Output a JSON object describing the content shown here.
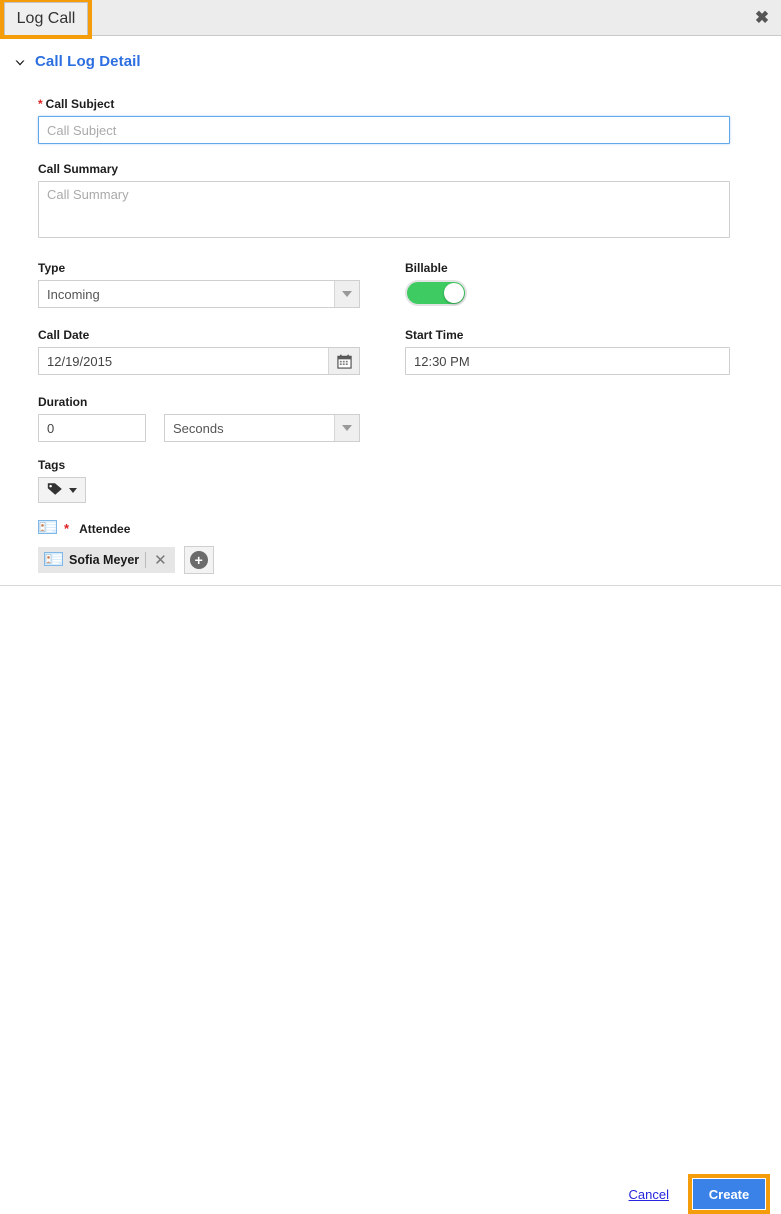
{
  "window": {
    "tab_label": "Log Call",
    "close_icon": "close-icon"
  },
  "section": {
    "title": "Call Log Detail",
    "chevron_icon": "chevron-down-icon",
    "expanded": true
  },
  "fields": {
    "call_subject": {
      "label": "Call Subject",
      "required_marker": "*",
      "value": "",
      "placeholder": "Call Subject",
      "focused": true
    },
    "call_summary": {
      "label": "Call Summary",
      "value": "",
      "placeholder": "Call Summary"
    },
    "type": {
      "label": "Type",
      "value": "Incoming",
      "options": [
        "Incoming"
      ],
      "arrow_icon": "chevron-down-icon"
    },
    "billable": {
      "label": "Billable",
      "state": "on",
      "on_color": "#3ecb62"
    },
    "call_date": {
      "label": "Call Date",
      "value": "12/19/2015",
      "calendar_icon": "calendar-icon"
    },
    "start_time": {
      "label": "Start Time",
      "value": "12:30 PM"
    },
    "duration": {
      "label": "Duration",
      "amount": "0",
      "unit": "Seconds",
      "unit_options": [
        "Seconds"
      ],
      "arrow_icon": "chevron-down-icon"
    },
    "tags": {
      "label": "Tags",
      "tag_icon": "tag-icon",
      "caret_icon": "chevron-down-icon"
    },
    "attendee": {
      "label": "Attendee",
      "required_marker": "*",
      "header_icon": "contact-card-icon",
      "chips": [
        {
          "name": "Sofia Meyer",
          "icon": "contact-card-icon",
          "remove_icon": "close-icon"
        }
      ],
      "add_button_icon": "plus-icon"
    }
  },
  "footer": {
    "cancel_label": "Cancel",
    "create_label": "Create",
    "create_color": "#3b82e8"
  },
  "highlights": {
    "color": "#f59c0b",
    "targets": [
      "tab-log-call",
      "create-button"
    ]
  }
}
